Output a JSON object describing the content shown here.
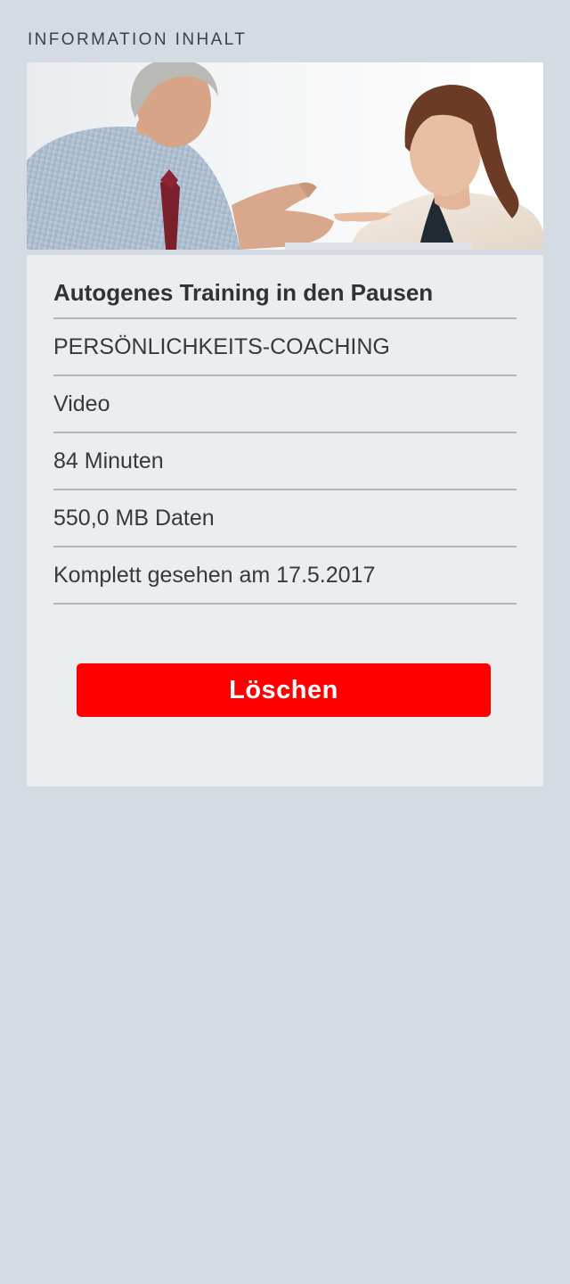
{
  "page": {
    "heading": "INFORMATION INHALT"
  },
  "content": {
    "title": "Autogenes Training in den Pausen",
    "details": [
      {
        "label": "PERSÖNLICHKEITS-COACHING"
      },
      {
        "label": "Video"
      },
      {
        "label": "84 Minuten"
      },
      {
        "label": "550,0 MB Daten"
      },
      {
        "label": "Komplett gesehen am 17.5.2017"
      }
    ],
    "delete_label": "Löschen"
  },
  "colors": {
    "background": "#d4dbe3",
    "card": "#ecedef",
    "divider": "#aeb6c3",
    "delete_button": "#ff0000",
    "text": "#33363b"
  }
}
